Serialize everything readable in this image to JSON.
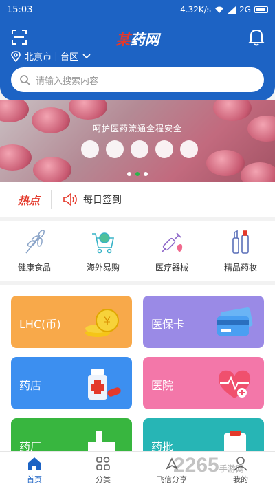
{
  "status_bar": {
    "time": "15:03",
    "speed": "4.32K/s",
    "network": "2G"
  },
  "header": {
    "logo_part1": "某",
    "logo_part2": "药网",
    "location": "北京市丰台区",
    "search_placeholder": "请输入搜索内容"
  },
  "banner": {
    "title": "呵护医药流通全程安全"
  },
  "hot": {
    "label": "热点",
    "sign": "每日签到"
  },
  "categories": [
    {
      "label": "健康食品",
      "icon": "wheat-icon"
    },
    {
      "label": "海外易购",
      "icon": "globe-cart-icon"
    },
    {
      "label": "医疗器械",
      "icon": "syringe-icon"
    },
    {
      "label": "精品药妆",
      "icon": "cosmetics-icon"
    }
  ],
  "cards": [
    {
      "label": "LHC(币)",
      "color": "#f8a94a",
      "icon": "coins-icon"
    },
    {
      "label": "医保卡",
      "color": "#9a8ae6",
      "icon": "card-icon"
    },
    {
      "label": "药店",
      "color": "#3c8ff0",
      "icon": "medicine-bottle-icon"
    },
    {
      "label": "医院",
      "color": "#f377a9",
      "icon": "heart-pulse-icon"
    },
    {
      "label": "药厂",
      "color": "#38b63f",
      "icon": "factory-icon"
    },
    {
      "label": "药批",
      "color": "#27b5b5",
      "icon": "clipboard-icon"
    }
  ],
  "nav": [
    {
      "label": "首页",
      "icon": "home-icon",
      "active": true
    },
    {
      "label": "分类",
      "icon": "grid-icon",
      "active": false
    },
    {
      "label": "飞信分享",
      "icon": "share-icon",
      "active": false
    },
    {
      "label": "我的",
      "icon": "user-icon",
      "active": false
    }
  ],
  "watermark": {
    "text": "2265",
    "sub": "手游网"
  }
}
